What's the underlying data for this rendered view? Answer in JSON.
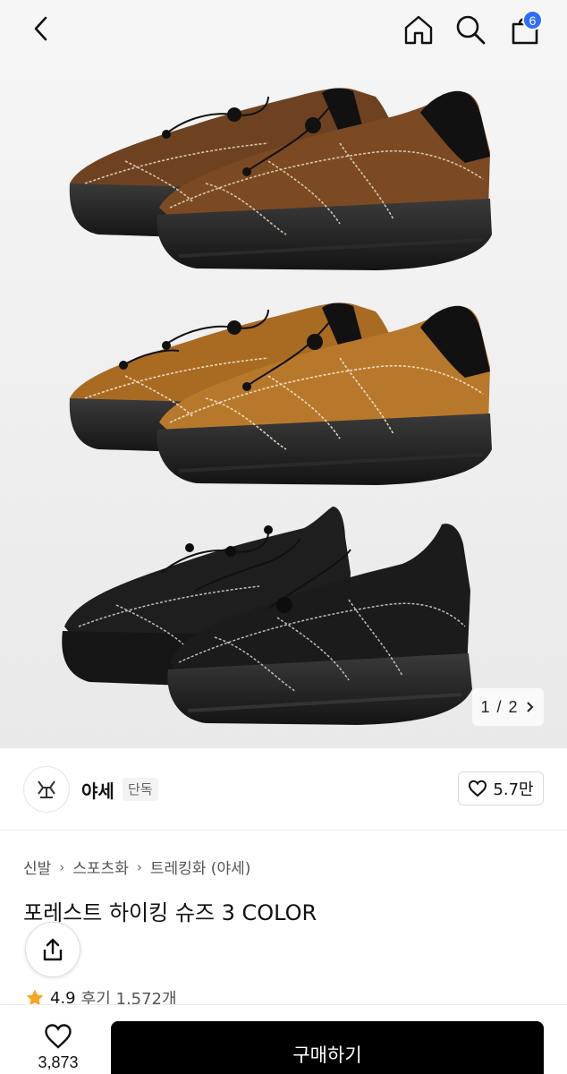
{
  "header": {
    "cart_count": "6"
  },
  "gallery": {
    "current_page": "1",
    "separator": "/",
    "total_pages": "2"
  },
  "brand": {
    "name": "야세",
    "tag": "단독",
    "likes": "5.7만"
  },
  "breadcrumb": [
    "신발",
    "스포츠화",
    "트레킹화 (야세)"
  ],
  "product": {
    "title": "포레스트 하이킹 슈즈 3 COLOR",
    "rating": "4.9",
    "reviews_label": "후기 1,572개"
  },
  "bottom_bar": {
    "wish_count": "3,873",
    "buy_label": "구매하기"
  },
  "colors": {
    "accent_badge": "#2f6bff",
    "star": "#f5a623",
    "shoe_brown": "#7b4a22",
    "shoe_tan": "#b8782b",
    "shoe_black": "#1b1b1b"
  },
  "icons": [
    "back-icon",
    "home-icon",
    "search-icon",
    "cart-icon",
    "chevron-right-icon",
    "heart-icon",
    "share-icon",
    "star-icon"
  ]
}
